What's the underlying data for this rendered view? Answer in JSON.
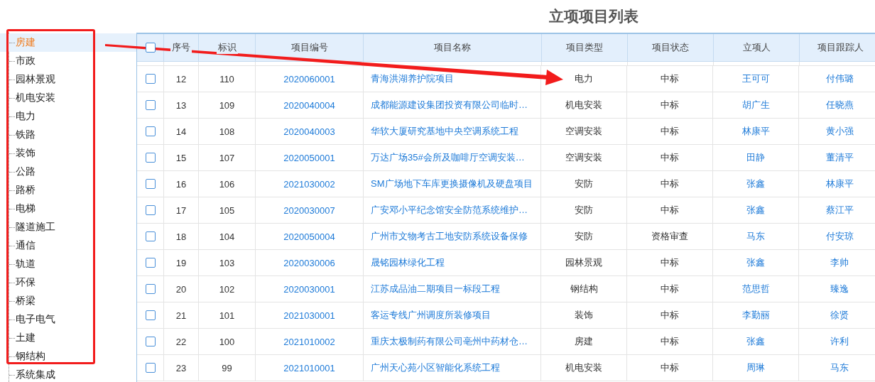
{
  "page_title": "立项项目列表",
  "tree": {
    "items": [
      {
        "label": "房建",
        "selected": true
      },
      {
        "label": "市政",
        "selected": false
      },
      {
        "label": "园林景观",
        "selected": false
      },
      {
        "label": "机电安装",
        "selected": false
      },
      {
        "label": "电力",
        "selected": false
      },
      {
        "label": "铁路",
        "selected": false
      },
      {
        "label": "装饰",
        "selected": false
      },
      {
        "label": "公路",
        "selected": false
      },
      {
        "label": "路桥",
        "selected": false
      },
      {
        "label": "电梯",
        "selected": false
      },
      {
        "label": "隧道施工",
        "selected": false
      },
      {
        "label": "通信",
        "selected": false
      },
      {
        "label": "轨道",
        "selected": false
      },
      {
        "label": "环保",
        "selected": false
      },
      {
        "label": "桥梁",
        "selected": false
      },
      {
        "label": "电子电气",
        "selected": false
      },
      {
        "label": "土建",
        "selected": false
      },
      {
        "label": "钢结构",
        "selected": false
      },
      {
        "label": "系统集成",
        "selected": false
      }
    ]
  },
  "table": {
    "header_checked": false,
    "columns": [
      "序号",
      "标识",
      "项目编号",
      "项目名称",
      "项目类型",
      "项目状态",
      "立项人",
      "项目跟踪人"
    ],
    "rows": [
      {
        "checked": false,
        "cells": [
          "12",
          "110",
          "2020060001",
          "青海洪湖养护院项目",
          "电力",
          "中标",
          "王可可",
          "付伟璐"
        ]
      },
      {
        "checked": false,
        "cells": [
          "13",
          "109",
          "2020040004",
          "成都能源建设集团投资有限公司临时…",
          "机电安装",
          "中标",
          "胡广生",
          "任晓燕"
        ]
      },
      {
        "checked": false,
        "cells": [
          "14",
          "108",
          "2020040003",
          "华软大厦研究基地中央空调系统工程",
          "空调安装",
          "中标",
          "林康平",
          "黄小强"
        ]
      },
      {
        "checked": false,
        "cells": [
          "15",
          "107",
          "2020050001",
          "万达广场35#会所及咖啡厅空调安装…",
          "空调安装",
          "中标",
          "田静",
          "董清平"
        ]
      },
      {
        "checked": false,
        "cells": [
          "16",
          "106",
          "2021030002",
          "SM广场地下车库更换摄像机及硬盘项目",
          "安防",
          "中标",
          "张鑫",
          "林康平"
        ]
      },
      {
        "checked": false,
        "cells": [
          "17",
          "105",
          "2020030007",
          "广安邓小平纪念馆安全防范系统维护…",
          "安防",
          "中标",
          "张鑫",
          "蔡江平"
        ]
      },
      {
        "checked": false,
        "cells": [
          "18",
          "104",
          "2020050004",
          "广州市文物考古工地安防系统设备保修",
          "安防",
          "资格审查",
          "马东",
          "付安琼"
        ]
      },
      {
        "checked": false,
        "cells": [
          "19",
          "103",
          "2020030006",
          "晟铭园林绿化工程",
          "园林景观",
          "中标",
          "张鑫",
          "李帅"
        ]
      },
      {
        "checked": false,
        "cells": [
          "20",
          "102",
          "2020030001",
          "江苏成品油二期项目一标段工程",
          "钢结构",
          "中标",
          "范思哲",
          "臻逸"
        ]
      },
      {
        "checked": false,
        "cells": [
          "21",
          "101",
          "2021030001",
          "客运专线广州调度所装修项目",
          "装饰",
          "中标",
          "李勤丽",
          "徐贤"
        ]
      },
      {
        "checked": false,
        "cells": [
          "22",
          "100",
          "2021010002",
          "重庆太极制药有限公司亳州中药材仓…",
          "房建",
          "中标",
          "张鑫",
          "许利"
        ]
      },
      {
        "checked": false,
        "cells": [
          "23",
          "99",
          "2021010001",
          "广州天心苑小区智能化系统工程",
          "机电安装",
          "中标",
          "周琳",
          "马东"
        ]
      }
    ]
  }
}
